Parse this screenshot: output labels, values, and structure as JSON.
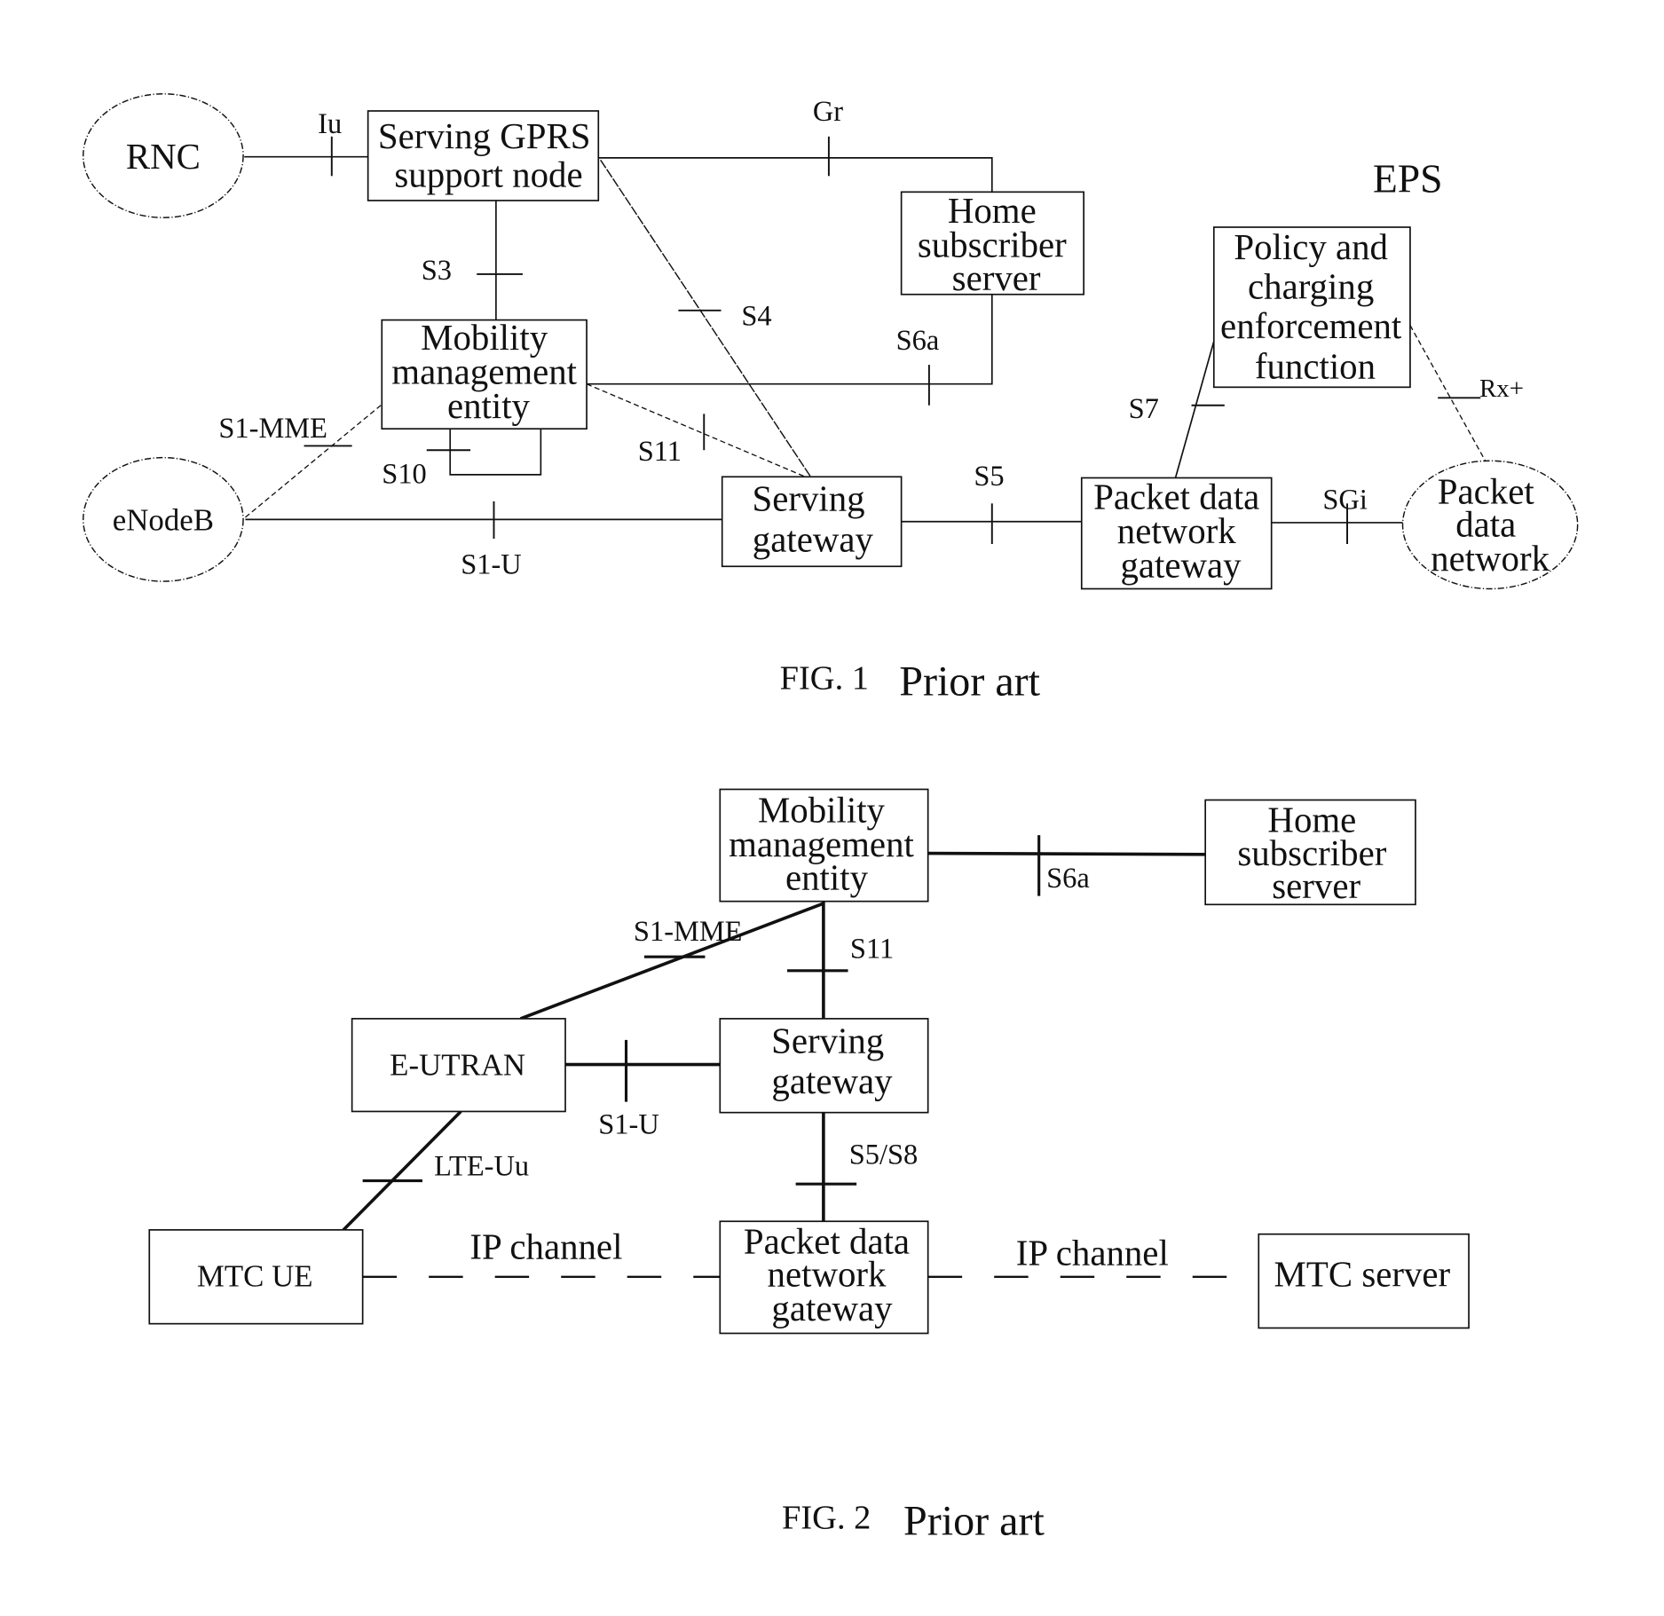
{
  "figure1": {
    "title_label": "EPS",
    "caption": {
      "fig": "FIG. 1",
      "note": "Prior art"
    },
    "nodes": {
      "rnc": {
        "shape": "ellipse",
        "lines": [
          "RNC"
        ]
      },
      "sgsn": {
        "shape": "box",
        "lines": [
          "Serving GPRS",
          "support node"
        ]
      },
      "hss": {
        "shape": "box",
        "lines": [
          "Home",
          "subscriber",
          "server"
        ]
      },
      "mme": {
        "shape": "box",
        "lines": [
          "Mobility",
          "management",
          "entity"
        ]
      },
      "enodeb": {
        "shape": "ellipse",
        "lines": [
          "eNodeB"
        ]
      },
      "sgw": {
        "shape": "box",
        "lines": [
          "Serving",
          "gateway"
        ]
      },
      "pgw": {
        "shape": "box",
        "lines": [
          "Packet data",
          "network",
          "gateway"
        ]
      },
      "pcef": {
        "shape": "box",
        "lines": [
          "Policy and",
          "charging",
          "enforcement",
          "function"
        ]
      },
      "pdn": {
        "shape": "ellipse",
        "lines": [
          "Packet",
          "data",
          "network"
        ]
      }
    },
    "interfaces": {
      "iu": {
        "label": "Iu",
        "from": "rnc",
        "to": "sgsn",
        "style": "solid"
      },
      "gr": {
        "label": "Gr",
        "from": "sgsn",
        "to": "hss",
        "style": "solid"
      },
      "s3": {
        "label": "S3",
        "from": "sgsn",
        "to": "mme",
        "style": "solid"
      },
      "s4": {
        "label": "S4",
        "from": "sgsn",
        "to": "sgw",
        "style": "dotted"
      },
      "s6a": {
        "label": "S6a",
        "from": "hss",
        "to": "mme",
        "style": "solid"
      },
      "s10": {
        "label": "S10",
        "from": "mme",
        "to": "mme",
        "style": "solid"
      },
      "s11": {
        "label": "S11",
        "from": "mme",
        "to": "sgw",
        "style": "dashed"
      },
      "s1mme": {
        "label": "S1-MME",
        "from": "enodeb",
        "to": "mme",
        "style": "dashed"
      },
      "s1u": {
        "label": "S1-U",
        "from": "enodeb",
        "to": "sgw",
        "style": "solid"
      },
      "s5": {
        "label": "S5",
        "from": "sgw",
        "to": "pgw",
        "style": "solid"
      },
      "s7": {
        "label": "S7",
        "from": "pgw",
        "to": "pcef",
        "style": "solid"
      },
      "rx": {
        "label": "Rx+",
        "from": "pcef",
        "to": "pdn",
        "style": "dashed"
      },
      "sgi": {
        "label": "SGi",
        "from": "pgw",
        "to": "pdn",
        "style": "solid"
      }
    }
  },
  "figure2": {
    "caption": {
      "fig": "FIG. 2",
      "note": "Prior art"
    },
    "nodes": {
      "mme": {
        "shape": "box",
        "lines": [
          "Mobility",
          "management",
          "entity"
        ]
      },
      "hss": {
        "shape": "box",
        "lines": [
          "Home",
          "subscriber",
          "server"
        ]
      },
      "eutran": {
        "shape": "box",
        "lines": [
          "E-UTRAN"
        ]
      },
      "sgw": {
        "shape": "box",
        "lines": [
          "Serving",
          "gateway"
        ]
      },
      "pgw": {
        "shape": "box",
        "lines": [
          "Packet data",
          "network",
          "gateway"
        ]
      },
      "mtc_ue": {
        "shape": "box",
        "lines": [
          "MTC UE"
        ]
      },
      "mtc_server": {
        "shape": "box",
        "lines": [
          "MTC server"
        ]
      }
    },
    "interfaces": {
      "s6a": {
        "label": "S6a",
        "from": "mme",
        "to": "hss",
        "style": "solid"
      },
      "s1mme": {
        "label": "S1-MME",
        "from": "eutran",
        "to": "mme",
        "style": "solid"
      },
      "s11": {
        "label": "S11",
        "from": "mme",
        "to": "sgw",
        "style": "solid"
      },
      "s1u": {
        "label": "S1-U",
        "from": "eutran",
        "to": "sgw",
        "style": "solid"
      },
      "s5s8": {
        "label": "S5/S8",
        "from": "sgw",
        "to": "pgw",
        "style": "solid"
      },
      "lteuu": {
        "label": "LTE-Uu",
        "from": "eutran",
        "to": "mtc_ue",
        "style": "solid"
      },
      "ip1": {
        "label": "IP channel",
        "from": "mtc_ue",
        "to": "pgw",
        "style": "dashed"
      },
      "ip2": {
        "label": "IP channel",
        "from": "pgw",
        "to": "mtc_server",
        "style": "dashed"
      }
    }
  }
}
